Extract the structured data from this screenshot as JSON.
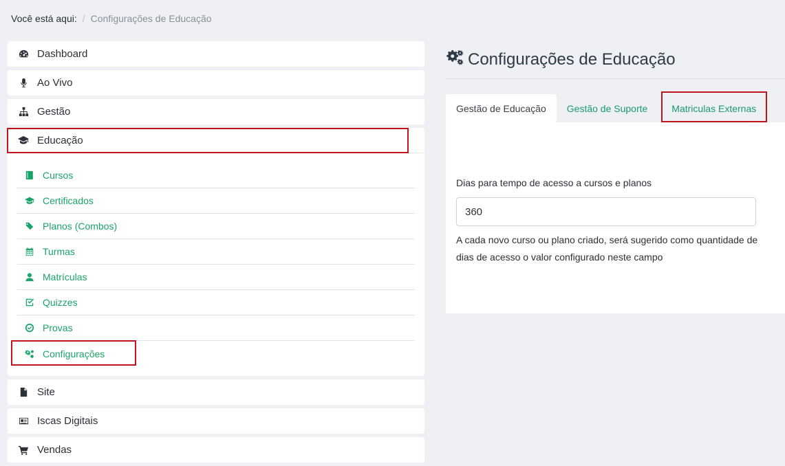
{
  "breadcrumb": {
    "lead": "Você está aqui:",
    "separator": "/",
    "current": "Configurações de Educação"
  },
  "sidebar": {
    "items_top": [
      {
        "label": "Dashboard",
        "icon": "dashboard-icon"
      },
      {
        "label": "Ao Vivo",
        "icon": "microphone-icon"
      },
      {
        "label": "Gestão",
        "icon": "sitemap-icon"
      }
    ],
    "education": {
      "label": "Educação",
      "icon": "graduation-cap-icon",
      "sub_items": [
        {
          "label": "Cursos",
          "icon": "book-icon"
        },
        {
          "label": "Certificados",
          "icon": "graduation-cap-icon"
        },
        {
          "label": "Planos (Combos)",
          "icon": "tags-icon"
        },
        {
          "label": "Turmas",
          "icon": "calendar-icon"
        },
        {
          "label": "Matrículas",
          "icon": "user-icon"
        },
        {
          "label": "Quizzes",
          "icon": "check-square-icon"
        },
        {
          "label": "Provas",
          "icon": "check-circle-icon"
        },
        {
          "label": "Configurações",
          "icon": "cogs-icon"
        }
      ]
    },
    "items_bottom": [
      {
        "label": "Site",
        "icon": "file-icon"
      },
      {
        "label": "Iscas Digitais",
        "icon": "id-card-icon"
      },
      {
        "label": "Vendas",
        "icon": "cart-icon"
      }
    ]
  },
  "main": {
    "title": "Configurações de Educação",
    "tabs": [
      {
        "label": "Gestão de Educação",
        "active": true
      },
      {
        "label": "Gestão de Suporte",
        "active": false
      },
      {
        "label": "Matriculas Externas",
        "active": false
      }
    ],
    "field": {
      "label": "Dias para tempo de acesso a cursos e planos",
      "value": "360",
      "help": "A cada novo curso ou plano criado, será sugerido como quantidade de dias de acesso o valor configurado neste campo"
    }
  },
  "colors": {
    "accent": "#1aa36a",
    "highlight": "#c0141c",
    "background": "#eef0f3"
  }
}
